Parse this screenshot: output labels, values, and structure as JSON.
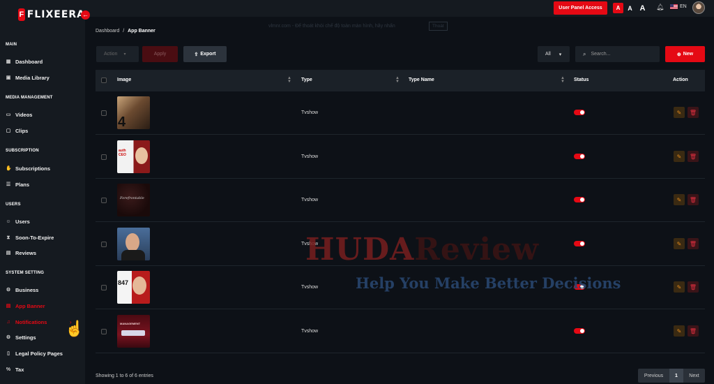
{
  "app": {
    "logo_mark": "F",
    "logo_text": "FLIXEERA",
    "collapse_icon": "arrow-left-icon"
  },
  "sidebar": {
    "sections": {
      "main": "MAIN",
      "media": "MEDIA MANAGEMENT",
      "subscription": "SUBSCRIPTION",
      "users": "USERS",
      "system": "SYSTEM SETTING"
    },
    "items": {
      "dashboard": "Dashboard",
      "media_library": "Media Library",
      "videos": "Videos",
      "clips": "Clips",
      "subscriptions": "Subscriptions",
      "plans": "Plans",
      "users": "Users",
      "soon_to_expire": "Soon-To-Expire",
      "reviews": "Reviews",
      "business": "Business",
      "app_banner": "App Banner",
      "notifications": "Notifications",
      "settings": "Settings",
      "legal_policy": "Legal Policy Pages",
      "tax": "Tax"
    },
    "active_item": "app_banner"
  },
  "topbar": {
    "user_panel_label": "User Panel Access",
    "font_small": "A",
    "font_medium": "A",
    "font_large": "A",
    "language": "EN"
  },
  "banner_note": {
    "text": "vlmnr.com - Để thoát khỏi chế độ toàn màn hình, hãy nhấn",
    "key": "Thoát"
  },
  "breadcrumb": {
    "root": "Dashboard",
    "separator": "/",
    "current": "App Banner"
  },
  "toolbar": {
    "action_placeholder": "Action",
    "apply_label": "Apply",
    "export_label": "Export",
    "filter_value": "All",
    "search_placeholder": "Search...",
    "new_label": "New"
  },
  "table": {
    "columns": {
      "image": "Image",
      "type": "Type",
      "type_name": "Type Name",
      "status": "Status",
      "action": "Action"
    },
    "rows": [
      {
        "type": "Tvshow",
        "type_name": "",
        "status": true,
        "thumb_overlay": "4"
      },
      {
        "type": "Tvshow",
        "type_name": "",
        "status": true,
        "thumb_overlay": "auth CEO"
      },
      {
        "type": "Tvshow",
        "type_name": "",
        "status": true,
        "thumb_overlay": "Forefrontable"
      },
      {
        "type": "Tvshow",
        "type_name": "",
        "status": true,
        "thumb_overlay": ""
      },
      {
        "type": "Tvshow",
        "type_name": "",
        "status": true,
        "thumb_overlay": "847"
      },
      {
        "type": "Tvshow",
        "type_name": "",
        "status": true,
        "thumb_overlay": "MANAGEMENT"
      }
    ]
  },
  "footer": {
    "showing_text": "Showing 1 to 6 of 6 entries",
    "prev_label": "Previous",
    "current_page": "1",
    "next_label": "Next"
  },
  "watermark": {
    "line1_a": "HUDA",
    "line1_b": "Review",
    "line2": "Help You Make Better Decisions"
  },
  "colors": {
    "accent": "#e50914",
    "background": "#0d1117",
    "sidebar": "#151a20"
  }
}
